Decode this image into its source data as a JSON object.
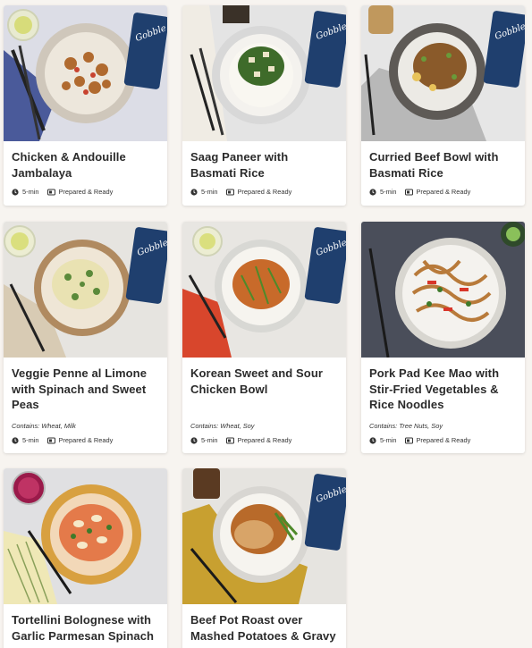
{
  "meals": [
    {
      "title": "Chicken & Andouille Jambalaya",
      "contains": "",
      "time": "5-min",
      "type": "Prepared & Ready",
      "brand": "Gobble"
    },
    {
      "title": "Saag Paneer with Basmati Rice",
      "contains": "",
      "time": "5-min",
      "type": "Prepared & Ready",
      "brand": "Gobble"
    },
    {
      "title": "Curried Beef Bowl with Basmati Rice",
      "contains": "",
      "time": "5-min",
      "type": "Prepared & Ready",
      "brand": "Gobble"
    },
    {
      "title": "Veggie Penne al Limone with Spinach and Sweet Peas",
      "contains": "Contains: Wheat, Milk",
      "time": "5-min",
      "type": "Prepared & Ready",
      "brand": "Gobble"
    },
    {
      "title": "Korean Sweet and Sour Chicken Bowl",
      "contains": "Contains: Wheat, Soy",
      "time": "5-min",
      "type": "Prepared & Ready",
      "brand": "Gobble"
    },
    {
      "title": "Pork Pad Kee Mao with Stir-Fried Vegetables & Rice Noodles",
      "contains": "Contains: Tree Nuts, Soy",
      "time": "5-min",
      "type": "Prepared & Ready",
      "brand": ""
    },
    {
      "title": "Tortellini Bolognese with Garlic Parmesan Spinach",
      "contains": "",
      "time": "",
      "type": "",
      "brand": ""
    },
    {
      "title": "Beef Pot Roast over Mashed Potatoes & Gravy",
      "contains": "",
      "time": "",
      "type": "",
      "brand": "Gobble"
    }
  ],
  "icons": {
    "time": "clock-icon",
    "type": "meal-box-icon"
  },
  "colors": {
    "brand_box": "#1f3f6e",
    "title": "#2b2b2b",
    "page_bg": "#f7f4f0"
  }
}
